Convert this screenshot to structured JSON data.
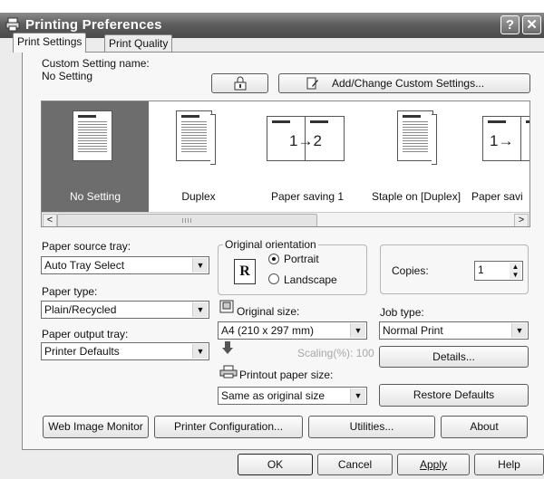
{
  "window": {
    "title": "Printing Preferences",
    "help_btn": "?",
    "close_btn": "✕"
  },
  "tabs": [
    {
      "label": "Print Settings",
      "active": true
    },
    {
      "label": "Print Quality",
      "active": false
    }
  ],
  "custom_setting": {
    "label": "Custom Setting name:",
    "value": "No Setting",
    "add_change_label": "Add/Change Custom Settings..."
  },
  "gallery": {
    "items": [
      {
        "caption": "No Setting",
        "icon": "single-page-icon",
        "selected": true
      },
      {
        "caption": "Duplex",
        "icon": "duplex-page-icon",
        "selected": false
      },
      {
        "caption": "Paper saving 1",
        "icon": "two-up-icon",
        "selected": false,
        "thumb_text": "1→2"
      },
      {
        "caption": "Staple on [Duplex]",
        "icon": "staple-duplex-icon",
        "selected": false
      },
      {
        "caption": "Paper savi",
        "icon": "two-up-icon",
        "selected": false,
        "thumb_text": "1→"
      }
    ],
    "scroll_left": "<",
    "scroll_right": ">"
  },
  "paper_source": {
    "label": "Paper source tray:",
    "value": "Auto Tray Select"
  },
  "paper_type": {
    "label": "Paper type:",
    "value": "Plain/Recycled"
  },
  "paper_output": {
    "label": "Paper output tray:",
    "value": "Printer Defaults"
  },
  "orientation": {
    "label": "Original orientation",
    "portrait": "Portrait",
    "landscape": "Landscape",
    "selected": "Portrait",
    "icon_letter": "R"
  },
  "copies": {
    "label": "Copies:",
    "value": "1"
  },
  "original_size": {
    "label": "Original size:",
    "value": "A4 (210 x 297 mm)"
  },
  "scaling": {
    "label": "Scaling(%):",
    "value": "100"
  },
  "printout_size": {
    "label": "Printout paper size:",
    "value": "Same as original size"
  },
  "job_type": {
    "label": "Job type:",
    "value": "Normal Print"
  },
  "buttons": {
    "details": "Details...",
    "restore_defaults": "Restore Defaults",
    "web_image_monitor": "Web Image Monitor",
    "printer_configuration": "Printer Configuration...",
    "utilities": "Utilities...",
    "about": "About",
    "ok": "OK",
    "cancel": "Cancel",
    "apply": "Apply",
    "help": "Help"
  }
}
